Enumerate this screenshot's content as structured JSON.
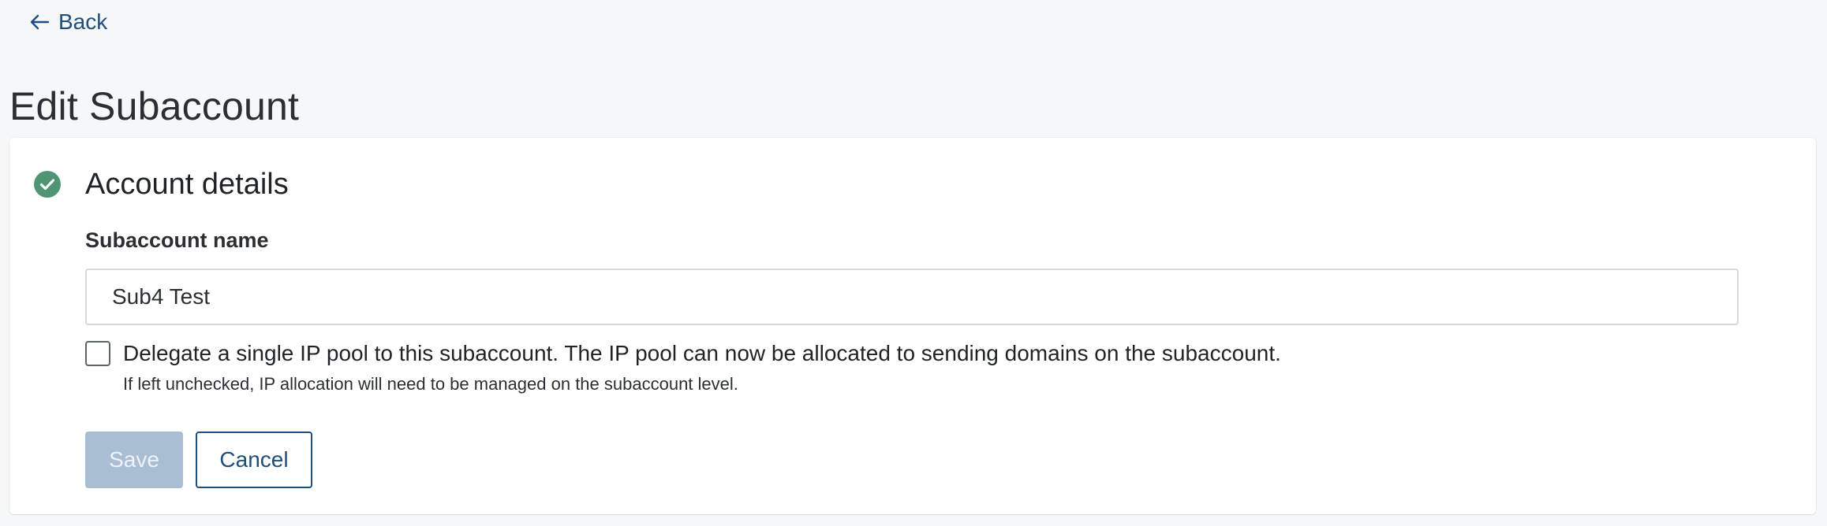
{
  "nav": {
    "back_label": "Back",
    "back_icon": "arrow-left-icon"
  },
  "page": {
    "title": "Edit Subaccount"
  },
  "section": {
    "status_icon": "check-circle-icon",
    "status_color": "#4f9473",
    "title": "Account details"
  },
  "form": {
    "name_label": "Subaccount name",
    "name_value": "Sub4 Test",
    "delegate_checked": false,
    "delegate_label": "Delegate a single IP pool to this subaccount. The IP pool can now be allocated to sending domains on the subaccount.",
    "delegate_help": "If left unchecked, IP allocation will need to be managed on the subaccount level."
  },
  "actions": {
    "save_label": "Save",
    "save_disabled": true,
    "cancel_label": "Cancel"
  },
  "colors": {
    "accent": "#1f4e7a",
    "disabled_button": "#a9bdd3",
    "background": "#f6f7f9"
  }
}
